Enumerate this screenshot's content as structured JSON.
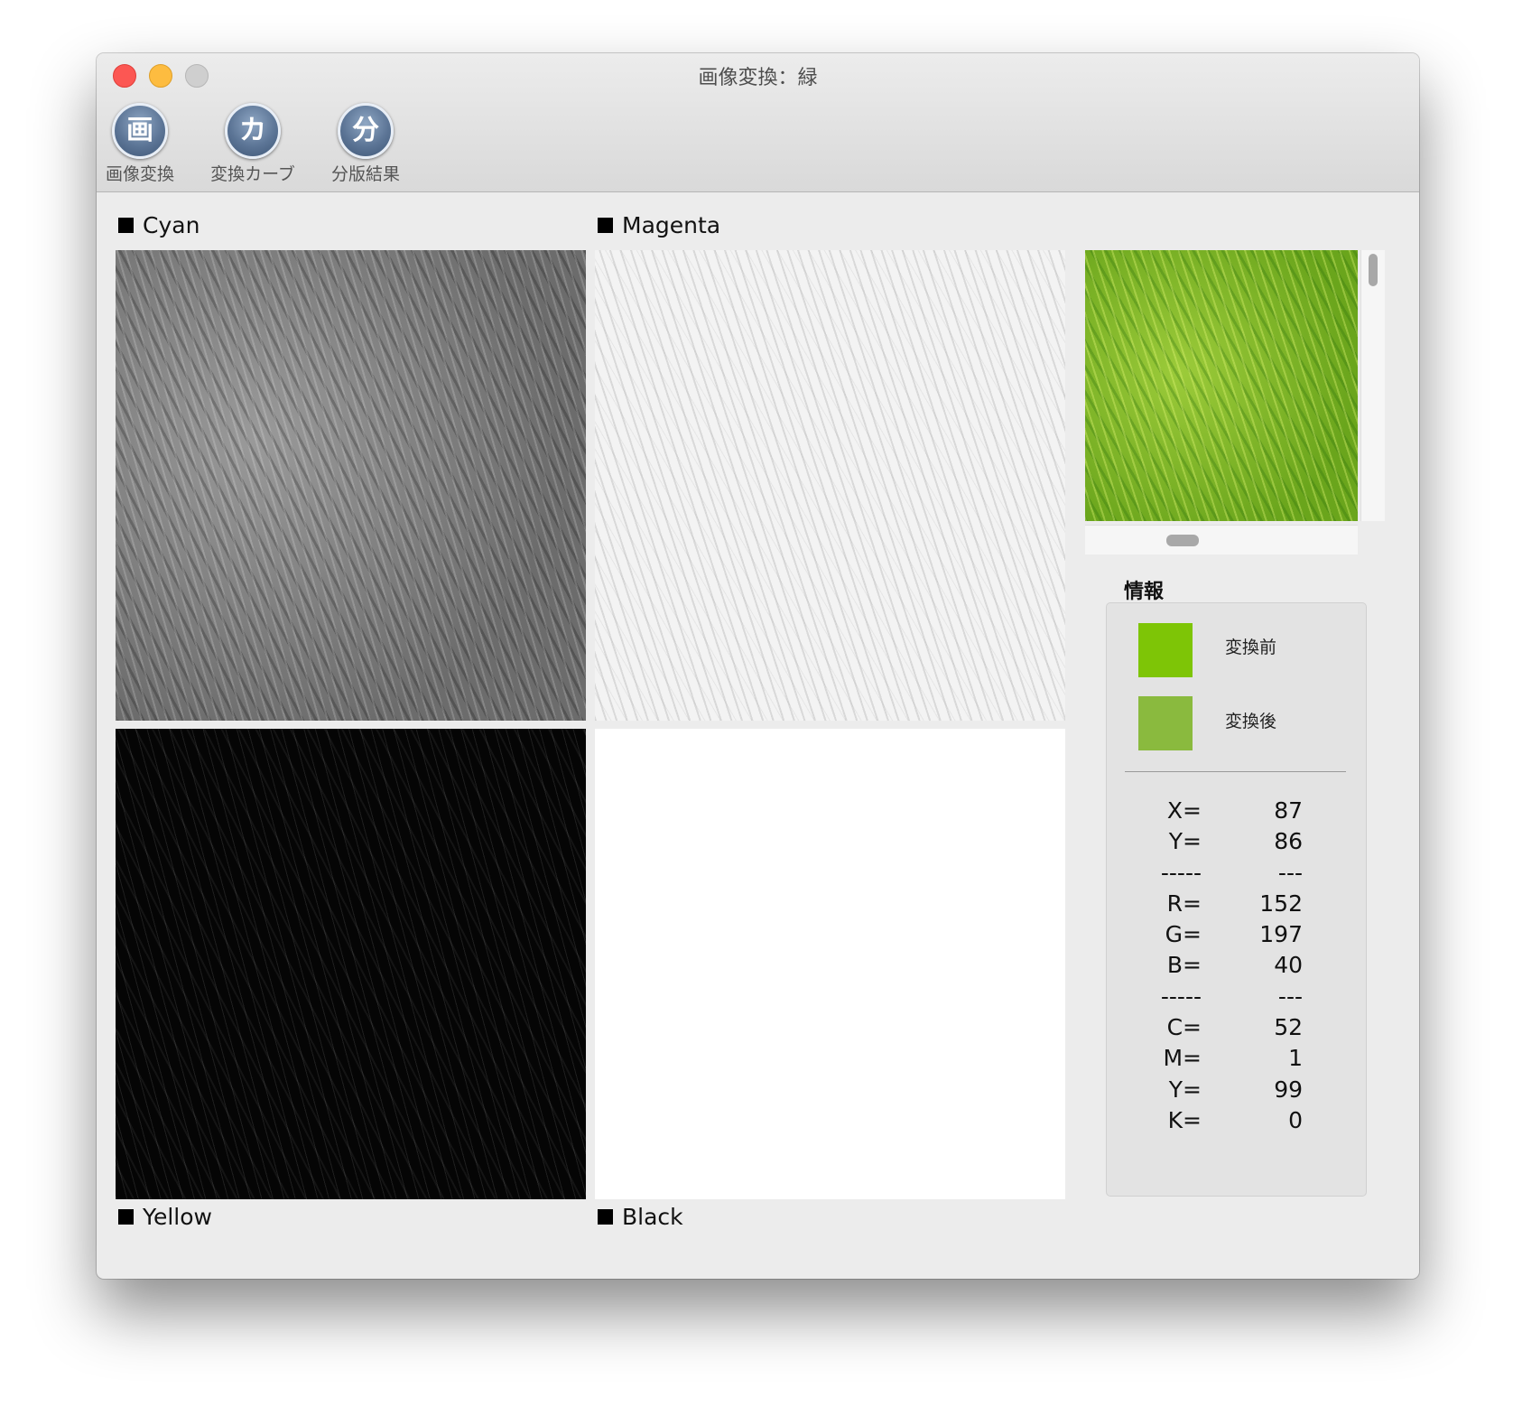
{
  "window": {
    "title": "画像変換：緑"
  },
  "toolbar": [
    {
      "glyph": "画",
      "label": "画像変換"
    },
    {
      "glyph": "カ",
      "label": "変換カーブ"
    },
    {
      "glyph": "分",
      "label": "分版結果"
    }
  ],
  "panels": {
    "cyan": "Cyan",
    "magenta": "Magenta",
    "yellow": "Yellow",
    "black": "Black"
  },
  "info": {
    "title": "情報",
    "before": {
      "label": "変換前",
      "color": "#7ec506"
    },
    "after": {
      "label": "変換後",
      "color": "#8aba3e"
    },
    "rows": [
      {
        "k": "X=",
        "v": "87"
      },
      {
        "k": "Y=",
        "v": "86"
      },
      {
        "k": "-----",
        "v": "---"
      },
      {
        "k": "R=",
        "v": "152"
      },
      {
        "k": "G=",
        "v": "197"
      },
      {
        "k": "B=",
        "v": "40"
      },
      {
        "k": "-----",
        "v": "---"
      },
      {
        "k": "C=",
        "v": "52"
      },
      {
        "k": "M=",
        "v": "1"
      },
      {
        "k": "Y=",
        "v": "99"
      },
      {
        "k": "K=",
        "v": "0"
      }
    ]
  }
}
